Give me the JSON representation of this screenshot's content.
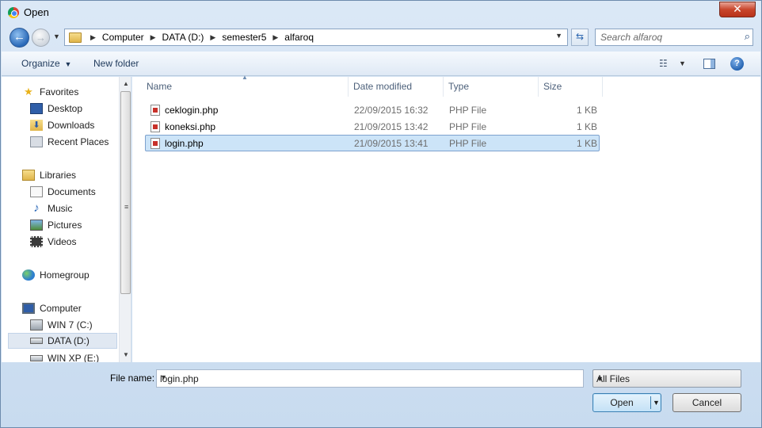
{
  "window": {
    "title": "Open"
  },
  "address": {
    "crumbs": [
      "Computer",
      "DATA (D:)",
      "semester5",
      "alfaroq"
    ]
  },
  "search": {
    "placeholder": "Search alfaroq"
  },
  "toolbar": {
    "organize_label": "Organize",
    "new_folder_label": "New folder"
  },
  "nav": {
    "favorites": {
      "label": "Favorites",
      "items": [
        "Desktop",
        "Downloads",
        "Recent Places"
      ]
    },
    "libraries": {
      "label": "Libraries",
      "items": [
        "Documents",
        "Music",
        "Pictures",
        "Videos"
      ]
    },
    "homegroup": {
      "label": "Homegroup"
    },
    "computer": {
      "label": "Computer",
      "items": [
        "WIN 7 (C:)",
        "DATA (D:)",
        "WIN XP (E:)"
      ],
      "selected": "DATA (D:)"
    }
  },
  "columns": {
    "name": "Name",
    "date": "Date modified",
    "type": "Type",
    "size": "Size"
  },
  "files": [
    {
      "name": "ceklogin.php",
      "date": "22/09/2015 16:32",
      "type": "PHP File",
      "size": "1 KB"
    },
    {
      "name": "koneksi.php",
      "date": "21/09/2015 13:42",
      "type": "PHP File",
      "size": "1 KB"
    },
    {
      "name": "login.php",
      "date": "21/09/2015 13:41",
      "type": "PHP File",
      "size": "1 KB"
    }
  ],
  "selected_file": "login.php",
  "bottom": {
    "file_name_label": "File name:",
    "file_name_value": "login.php",
    "filter_value": "All Files",
    "open_label": "Open",
    "cancel_label": "Cancel"
  }
}
